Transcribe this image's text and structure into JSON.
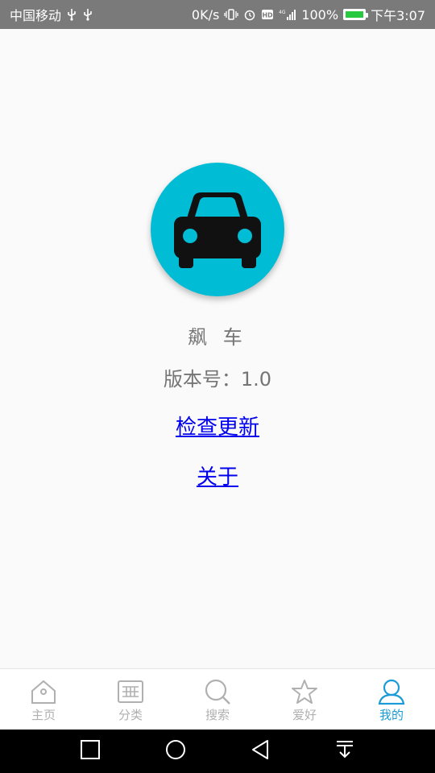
{
  "status_bar": {
    "carrier": "中国移动",
    "speed": "0K/s",
    "battery_percent": "100%",
    "time": "下午3:07"
  },
  "app": {
    "name": "飙 车",
    "version": "版本号：1.0",
    "check_update": "检查更新",
    "about": "关于",
    "logo_color": "#00bcd4"
  },
  "tabbar": {
    "items": [
      {
        "label": "主页",
        "icon": "home-icon",
        "active": false
      },
      {
        "label": "分类",
        "icon": "grid-icon",
        "active": false
      },
      {
        "label": "搜索",
        "icon": "search-icon",
        "active": false
      },
      {
        "label": "爱好",
        "icon": "star-icon",
        "active": false
      },
      {
        "label": "我的",
        "icon": "user-icon",
        "active": true
      }
    ],
    "active_color": "#1a9bd7",
    "inactive_color": "#b0b0b0"
  },
  "navbar": {
    "buttons": [
      "recents-button",
      "home-button",
      "back-button",
      "notification-pull-button"
    ]
  }
}
